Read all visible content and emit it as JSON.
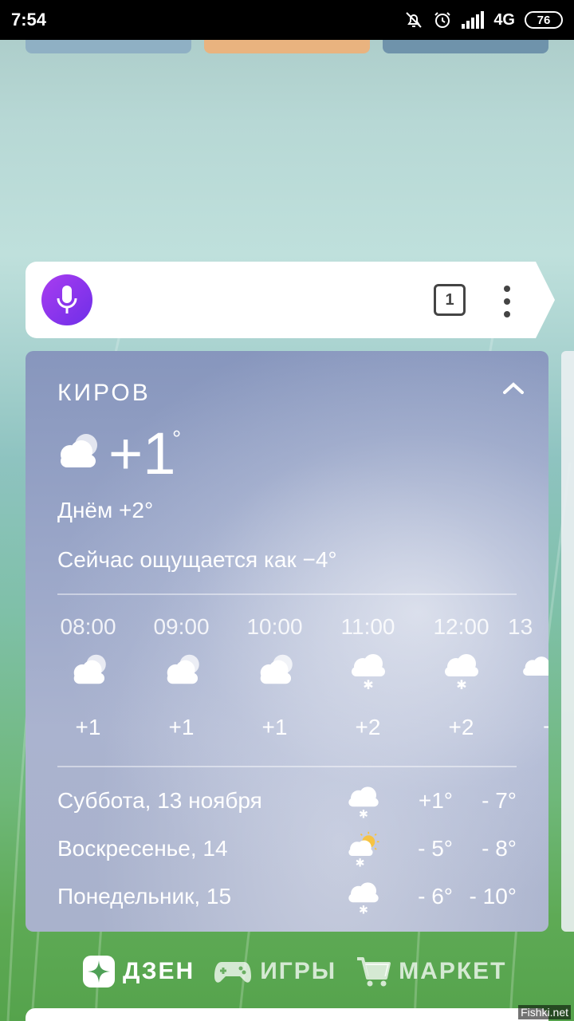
{
  "status_bar": {
    "time": "7:54",
    "network": "4G",
    "battery": "76",
    "icons": [
      "bell-off-icon",
      "alarm-icon",
      "signal-icon",
      "battery-icon"
    ]
  },
  "search": {
    "tabs_count": "1",
    "mic_color": "#8a35ec"
  },
  "weather": {
    "city": "КИРОВ",
    "current_temp": "+1",
    "degree": "°",
    "condition_icon": "cloudy-icon",
    "day_temp": "Днём +2°",
    "feels_like": "Сейчас ощущается как −4°",
    "hourly": [
      {
        "time": "08:00",
        "icon": "cloudy-icon",
        "temp": "+1"
      },
      {
        "time": "09:00",
        "icon": "cloudy-icon",
        "temp": "+1"
      },
      {
        "time": "10:00",
        "icon": "cloudy-icon",
        "temp": "+1"
      },
      {
        "time": "11:00",
        "icon": "cloud-snow-icon",
        "temp": "+2"
      },
      {
        "time": "12:00",
        "icon": "cloud-snow-icon",
        "temp": "+2"
      },
      {
        "time": "13",
        "icon": "cloud-snow-icon",
        "temp": "+"
      }
    ],
    "daily": [
      {
        "day": "Суббота, 13 ноября",
        "icon": "cloud-snow-icon",
        "high": "+1°",
        "low": "- 7°"
      },
      {
        "day": "Воскресенье, 14",
        "icon": "sun-cloud-snow-icon",
        "high": "- 5°",
        "low": "- 8°"
      },
      {
        "day": "Понедельник, 15",
        "icon": "cloud-snow-icon",
        "high": "- 6°",
        "low": "- 10°"
      }
    ]
  },
  "links": {
    "dzen": "ДЗЕН",
    "games": "ИГРЫ",
    "market": "МАРКЕТ"
  },
  "watermark": "Fishki.net"
}
